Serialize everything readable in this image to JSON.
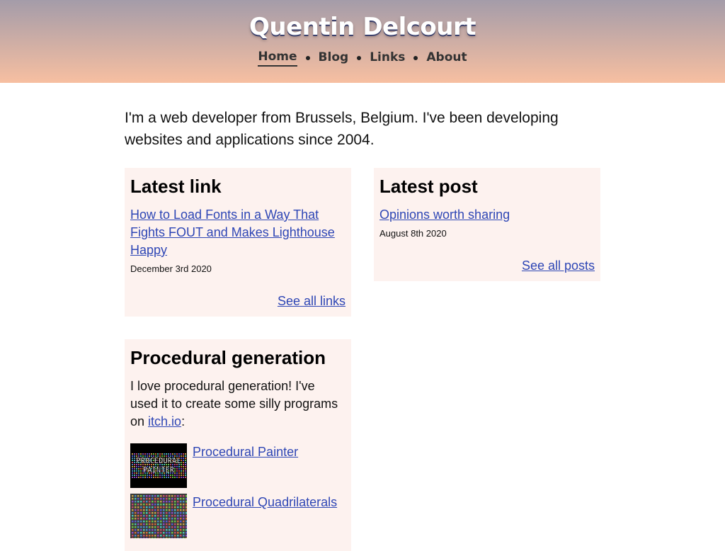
{
  "site": {
    "title": "Quentin Delcourt"
  },
  "nav": {
    "items": [
      {
        "label": "Home",
        "active": true
      },
      {
        "label": "Blog"
      },
      {
        "label": "Links"
      },
      {
        "label": "About"
      }
    ]
  },
  "intro": "I'm a web developer from Brussels, Belgium. I've been developing websites and applications since 2004.",
  "latest_link": {
    "heading": "Latest link",
    "title": "How to Load Fonts in a Way That Fights FOUT and Makes Lighthouse Happy",
    "date": "December 3rd 2020",
    "see_all": "See all links"
  },
  "latest_post": {
    "heading": "Latest post",
    "title": "Opinions worth sharing",
    "date": "August 8th 2020",
    "see_all": "See all posts"
  },
  "procedural": {
    "heading": "Procedural generation",
    "text_before": "I love procedural generation! I've used it to create some silly programs on ",
    "itch_link": "itch.io",
    "text_after": ":",
    "projects": [
      {
        "title": "Procedural Painter",
        "thumb_text": "PROCEDURAL PAINTER"
      },
      {
        "title": "Procedural Quadrilaterals"
      }
    ]
  },
  "colors": {
    "header_top": "#a49ca9",
    "header_bottom": "#f7bfa1",
    "card_bg": "#fdf2ef",
    "link": "#2e46b5"
  }
}
